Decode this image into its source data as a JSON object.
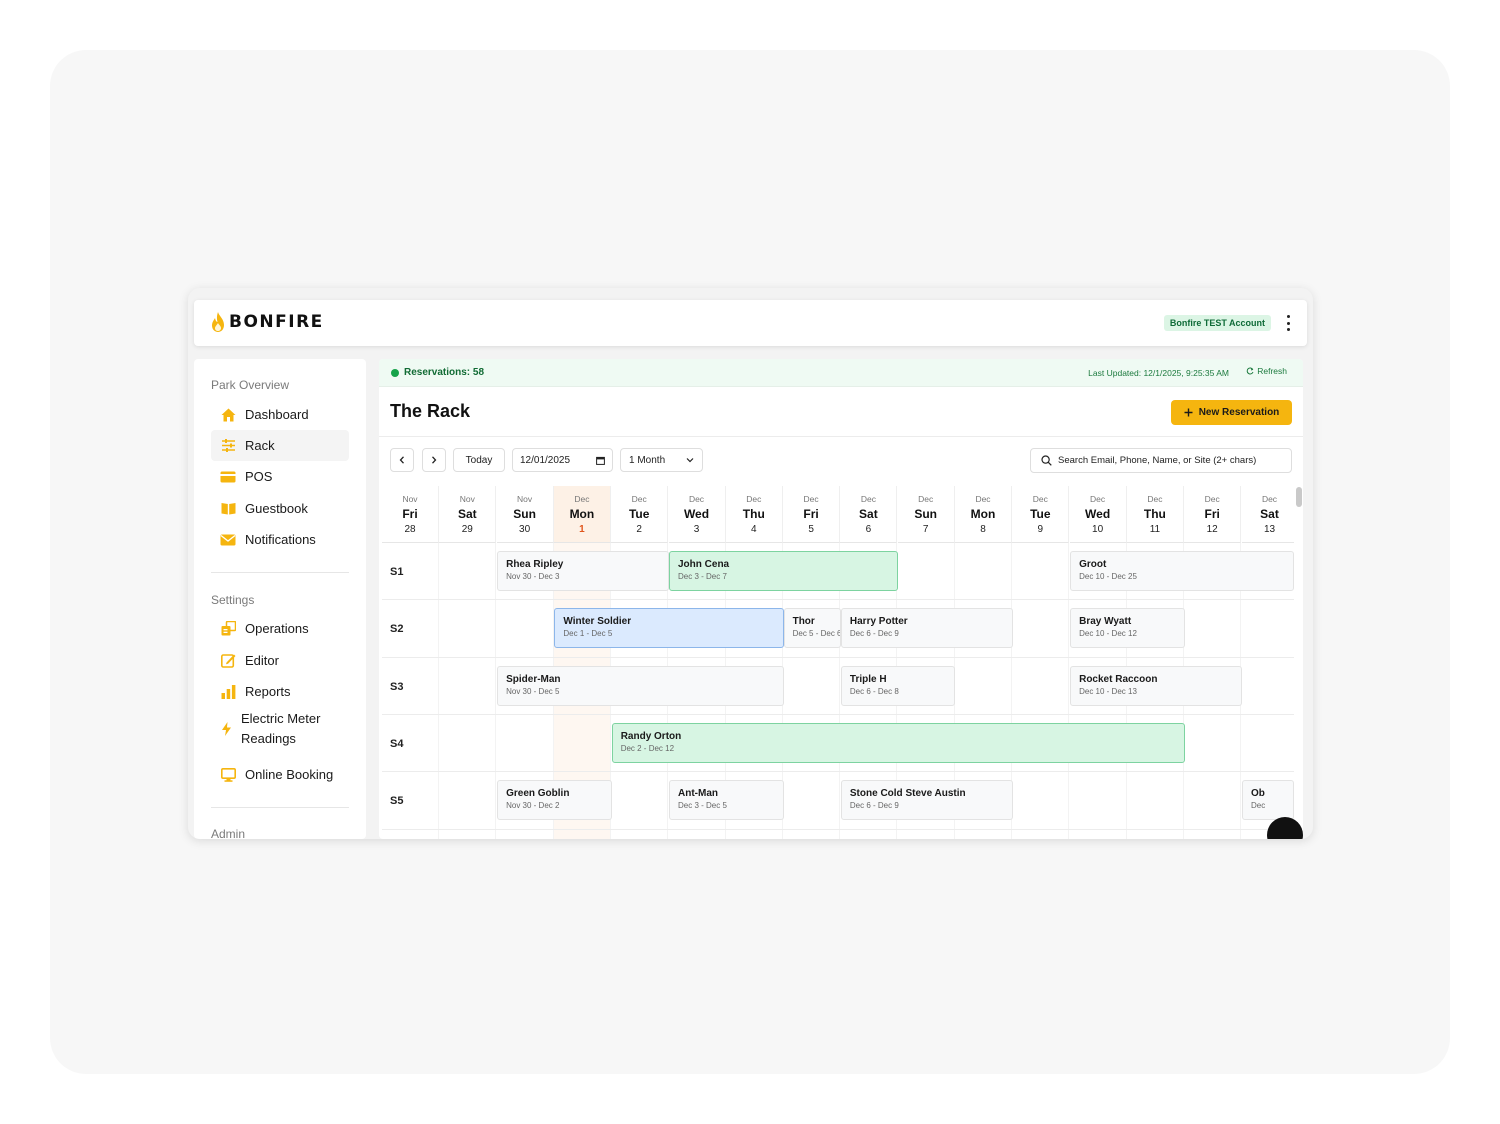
{
  "app": {
    "brand": "BONFIRE",
    "account_badge": "Bonfire TEST Account"
  },
  "sidebar": {
    "sections": [
      {
        "label": "Park Overview"
      },
      {
        "label": "Settings"
      },
      {
        "label": "Admin"
      }
    ],
    "items": [
      {
        "label": "Dashboard",
        "icon": "home-icon"
      },
      {
        "label": "Rack",
        "icon": "sliders-icon",
        "active": true
      },
      {
        "label": "POS",
        "icon": "credit-card-icon"
      },
      {
        "label": "Guestbook",
        "icon": "book-icon"
      },
      {
        "label": "Notifications",
        "icon": "mail-icon"
      },
      {
        "label": "Operations",
        "icon": "operations-icon"
      },
      {
        "label": "Editor",
        "icon": "edit-icon"
      },
      {
        "label": "Reports",
        "icon": "bar-chart-icon"
      },
      {
        "label": "Electric Meter Readings",
        "label_line1": "Electric Meter",
        "label_line2": "Readings",
        "icon": "lightning-icon"
      },
      {
        "label": "Online Booking",
        "icon": "monitor-icon"
      }
    ]
  },
  "status": {
    "reservations": "Reservations: 58",
    "last_updated": "Last Updated: 12/1/2025, 9:25:35 AM",
    "refresh": "Refresh"
  },
  "page": {
    "title": "The Rack",
    "new_reservation": "New Reservation"
  },
  "toolbar": {
    "today": "Today",
    "date_value": "12/01/2025",
    "range_value": "1 Month",
    "search_placeholder": "Search Email, Phone, Name, or Site (2+ chars)"
  },
  "days": [
    {
      "month": "Nov",
      "weekday": "Fri",
      "num": "28"
    },
    {
      "month": "Nov",
      "weekday": "Sat",
      "num": "29"
    },
    {
      "month": "Nov",
      "weekday": "Sun",
      "num": "30"
    },
    {
      "month": "Dec",
      "weekday": "Mon",
      "num": "1",
      "today": true
    },
    {
      "month": "Dec",
      "weekday": "Tue",
      "num": "2"
    },
    {
      "month": "Dec",
      "weekday": "Wed",
      "num": "3"
    },
    {
      "month": "Dec",
      "weekday": "Thu",
      "num": "4"
    },
    {
      "month": "Dec",
      "weekday": "Fri",
      "num": "5"
    },
    {
      "month": "Dec",
      "weekday": "Sat",
      "num": "6"
    },
    {
      "month": "Dec",
      "weekday": "Sun",
      "num": "7"
    },
    {
      "month": "Dec",
      "weekday": "Mon",
      "num": "8"
    },
    {
      "month": "Dec",
      "weekday": "Tue",
      "num": "9"
    },
    {
      "month": "Dec",
      "weekday": "Wed",
      "num": "10"
    },
    {
      "month": "Dec",
      "weekday": "Thu",
      "num": "11"
    },
    {
      "month": "Dec",
      "weekday": "Fri",
      "num": "12"
    },
    {
      "month": "Dec",
      "weekday": "Sat",
      "num": "13"
    }
  ],
  "sites": [
    "S1",
    "S2",
    "S3",
    "S4",
    "S5"
  ],
  "reservations": [
    {
      "site": 0,
      "start": 2,
      "end": 5,
      "name": "Rhea Ripley",
      "dates": "Nov 30 - Dec 3",
      "color": "gray"
    },
    {
      "site": 0,
      "start": 5,
      "end": 9,
      "name": "John Cena",
      "dates": "Dec 3 - Dec 7",
      "color": "green"
    },
    {
      "site": 0,
      "start": 12,
      "end": 27,
      "name": "Groot",
      "dates": "Dec 10 - Dec 25",
      "color": "gray"
    },
    {
      "site": 1,
      "start": 3,
      "end": 7,
      "name": "Winter Soldier",
      "dates": "Dec 1 - Dec 5",
      "color": "blue"
    },
    {
      "site": 1,
      "start": 7,
      "end": 8,
      "name": "Thor",
      "dates": "Dec 5 - Dec 6",
      "color": "gray"
    },
    {
      "site": 1,
      "start": 8,
      "end": 11,
      "name": "Harry Potter",
      "dates": "Dec 6 - Dec 9",
      "color": "gray"
    },
    {
      "site": 1,
      "start": 12,
      "end": 14,
      "name": "Bray Wyatt",
      "dates": "Dec 10 - Dec 12",
      "color": "gray"
    },
    {
      "site": 2,
      "start": 2,
      "end": 7,
      "name": "Spider-Man",
      "dates": "Nov 30 - Dec 5",
      "color": "gray"
    },
    {
      "site": 2,
      "start": 8,
      "end": 10,
      "name": "Triple H",
      "dates": "Dec 6 - Dec 8",
      "color": "gray"
    },
    {
      "site": 2,
      "start": 12,
      "end": 15,
      "name": "Rocket Raccoon",
      "dates": "Dec 10 - Dec 13",
      "color": "gray"
    },
    {
      "site": 3,
      "start": 4,
      "end": 14,
      "name": "Randy Orton",
      "dates": "Dec 2 - Dec 12",
      "color": "green"
    },
    {
      "site": 4,
      "start": 2,
      "end": 4,
      "name": "Green Goblin",
      "dates": "Nov 30 - Dec 2",
      "color": "gray"
    },
    {
      "site": 4,
      "start": 5,
      "end": 7,
      "name": "Ant-Man",
      "dates": "Dec 3 - Dec 5",
      "color": "gray"
    },
    {
      "site": 4,
      "start": 8,
      "end": 11,
      "name": "Stone Cold Steve Austin",
      "dates": "Dec 6 - Dec 9",
      "color": "gray"
    },
    {
      "site": 4,
      "start": 15,
      "end": 18,
      "name": "Ob",
      "dates": "Dec",
      "color": "gray"
    }
  ],
  "colors": {
    "accent": "#f5b50f",
    "success": "#16a34a",
    "today": "#e0551b"
  }
}
